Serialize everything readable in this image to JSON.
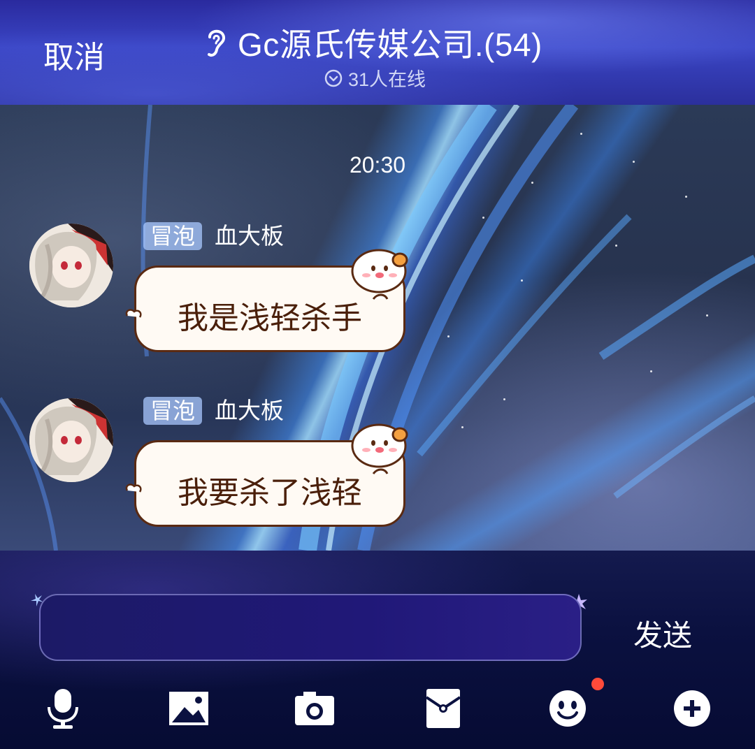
{
  "header": {
    "cancel_label": "取消",
    "title": "Gc源氏传媒公司.(54)",
    "online_status": "31人在线"
  },
  "chat": {
    "timestamp": "20:30",
    "messages": [
      {
        "badge": "冒泡",
        "sender": "血大板",
        "text": "我是浅轻杀手"
      },
      {
        "badge": "冒泡",
        "sender": "血大板",
        "text": "我要杀了浅轻"
      }
    ]
  },
  "composer": {
    "input_value": "",
    "send_label": "发送"
  },
  "toolbar": {
    "icons": [
      "microphone-icon",
      "image-icon",
      "camera-icon",
      "red-envelope-icon",
      "emoji-icon",
      "plus-icon"
    ],
    "emoji_has_notification": true
  },
  "colors": {
    "header_bg": "#3a45c4",
    "bubble_bg": "#fffaf4",
    "bubble_border": "#5a2a12",
    "bubble_text": "#4a1f0a",
    "badge_bg": "#aac8ff",
    "notification_dot": "#ff4a3a"
  }
}
